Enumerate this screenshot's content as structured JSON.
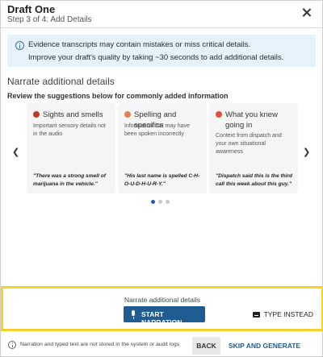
{
  "header": {
    "title": "Draft One",
    "step": "Step 3 of 4: Add Details"
  },
  "info": {
    "line1": "Evidence transcripts may contain mistakes or miss critical details.",
    "line2": "Improve your draft's quality by taking ~30 seconds to add additional details."
  },
  "section": {
    "title": "Narrate additional details",
    "subtitle": "Review the suggestions below for commonly added information"
  },
  "cards": [
    {
      "icon": "nose-icon",
      "icon_color": "#c0392b",
      "title": "Sights and smells",
      "description": "Important sensory details not in the audio",
      "quote": "\"There was a strong smell of marijuana in the vehicle.\""
    },
    {
      "icon": "spelling-icon",
      "icon_color": "#e67e5a",
      "title": "Spelling and specifics",
      "description": "Information that may have been spoken incorrectly",
      "quote": "\"His last name is spelled C-H-O-U-D-H-U-R-Y.\""
    },
    {
      "icon": "pin-icon",
      "icon_color": "#e74c3c",
      "title": "What you knew going in",
      "description": "Context from dispatch and your own situational awareness",
      "quote": "\"Dispatch said this is the third call this week about this guy.\""
    }
  ],
  "carousel": {
    "active_index": 0,
    "total": 3
  },
  "narrate_panel": {
    "label": "Narrate additional details",
    "start_button": "START NARRATION",
    "type_button": "TYPE INSTEAD"
  },
  "footer": {
    "note": "Narration and typed text are not stored in the system or audit logs",
    "back_button": "BACK",
    "skip_button": "SKIP AND GENERATE DRAFT"
  },
  "colors": {
    "accent": "#1f5c92",
    "highlight_border": "#f2d22b",
    "info_bg": "#e5f1fb"
  }
}
